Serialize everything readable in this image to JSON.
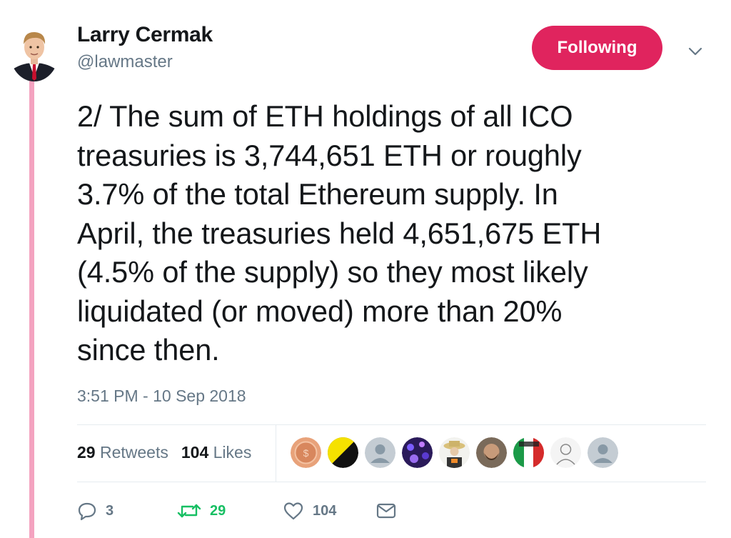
{
  "author": {
    "display_name": "Larry Cermak",
    "handle": "@lawmaster"
  },
  "follow_button": {
    "label": "Following",
    "color": "#e0245e"
  },
  "tweet": {
    "lines": [
      "2/ The sum of ETH holdings of all ICO",
      "treasuries is 3,744,651 ETH or roughly",
      "3.7% of the total Ethereum supply. In",
      "April, the treasuries held 4,651,675 ETH",
      "(4.5% of the supply) so they most likely",
      "liquidated (or moved) more than 20%",
      "since then."
    ],
    "timestamp": "3:51 PM - 10 Sep 2018"
  },
  "stats": {
    "retweets_count": "29",
    "retweets_label": "Retweets",
    "likes_count": "104",
    "likes_label": "Likes"
  },
  "liker_avatars": [
    "coin-avatar",
    "black-yellow-flag-avatar",
    "default-avatar",
    "purple-crowd-avatar",
    "hat-person-avatar",
    "bearded-man-avatar",
    "italy-flag-avatar",
    "sketch-person-avatar",
    "default-avatar"
  ],
  "actions": {
    "reply_count": "3",
    "retweet_count": "29",
    "like_count": "104"
  },
  "colors": {
    "thread_line": "#f4a3c0",
    "retweet_green": "#17bf63",
    "muted": "#657786"
  }
}
